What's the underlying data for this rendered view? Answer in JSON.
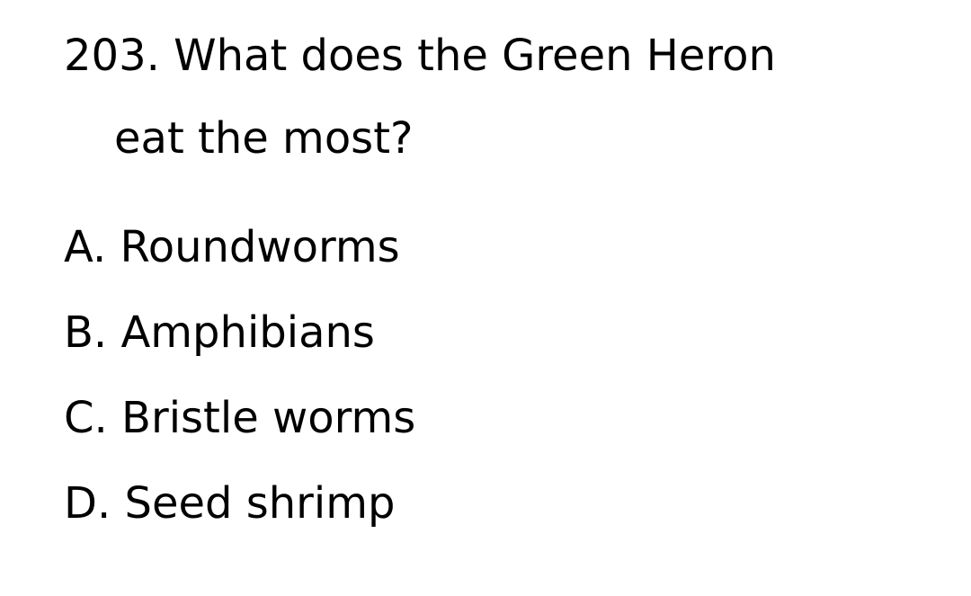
{
  "question": {
    "number": "203.",
    "line1": "What does the Green Heron",
    "line2": "eat the most?"
  },
  "options": [
    {
      "letter": "A.",
      "text": "Roundworms"
    },
    {
      "letter": "B.",
      "text": "Amphibians"
    },
    {
      "letter": "C.",
      "text": "Bristle worms"
    },
    {
      "letter": "D.",
      "text": "Seed shrimp"
    }
  ]
}
